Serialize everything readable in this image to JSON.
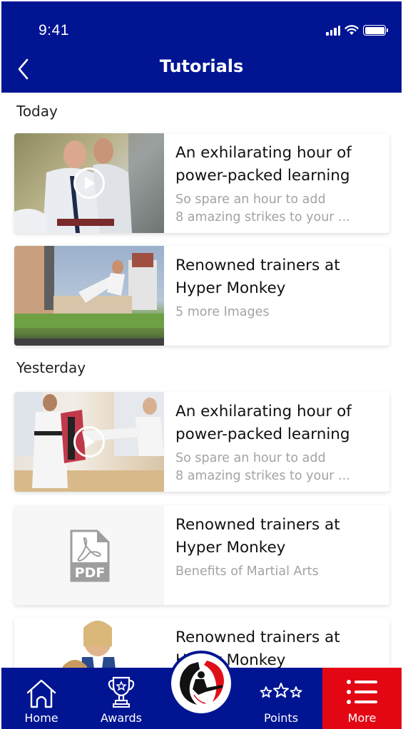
{
  "status_bar": {
    "time": "9:41"
  },
  "header": {
    "title": "Tutorials",
    "back_icon": "chevron-left-icon"
  },
  "colors": {
    "primary": "#011592",
    "accent": "#e30613",
    "subtitle": "#a3a3a3"
  },
  "sections": [
    {
      "label": "Today",
      "items": [
        {
          "type": "video",
          "title_line1": "An exhilarating hour of",
          "title_line2": "power-packed learning",
          "sub_line1": "So spare an hour to add",
          "sub_line2": "8 amazing strikes to your ..."
        },
        {
          "type": "gallery",
          "title_line1": "Renowned trainers at",
          "title_line2": "Hyper Monkey",
          "sub_line1": "5 more Images"
        }
      ]
    },
    {
      "label": "Yesterday",
      "items": [
        {
          "type": "video",
          "title_line1": "An exhilarating hour of",
          "title_line2": "power-packed learning",
          "sub_line1": "So spare an hour to add",
          "sub_line2": "8 amazing strikes to your ..."
        },
        {
          "type": "pdf",
          "title_line1": "Renowned trainers at",
          "title_line2": "Hyper Monkey",
          "sub_line1": "Benefits of Martial Arts",
          "pdf_label": "PDF"
        },
        {
          "type": "image",
          "title_line1": "Renowned trainers at",
          "title_line2": "Hyper Monkey"
        }
      ]
    }
  ],
  "bottom_nav": {
    "items": [
      {
        "label": "Home",
        "icon": "home-icon"
      },
      {
        "label": "Awards",
        "icon": "trophy-icon"
      },
      {
        "label": "",
        "icon": "logo-icon"
      },
      {
        "label": "Points",
        "icon": "stars-icon"
      },
      {
        "label": "More",
        "icon": "menu-list-icon",
        "active": true
      }
    ]
  }
}
